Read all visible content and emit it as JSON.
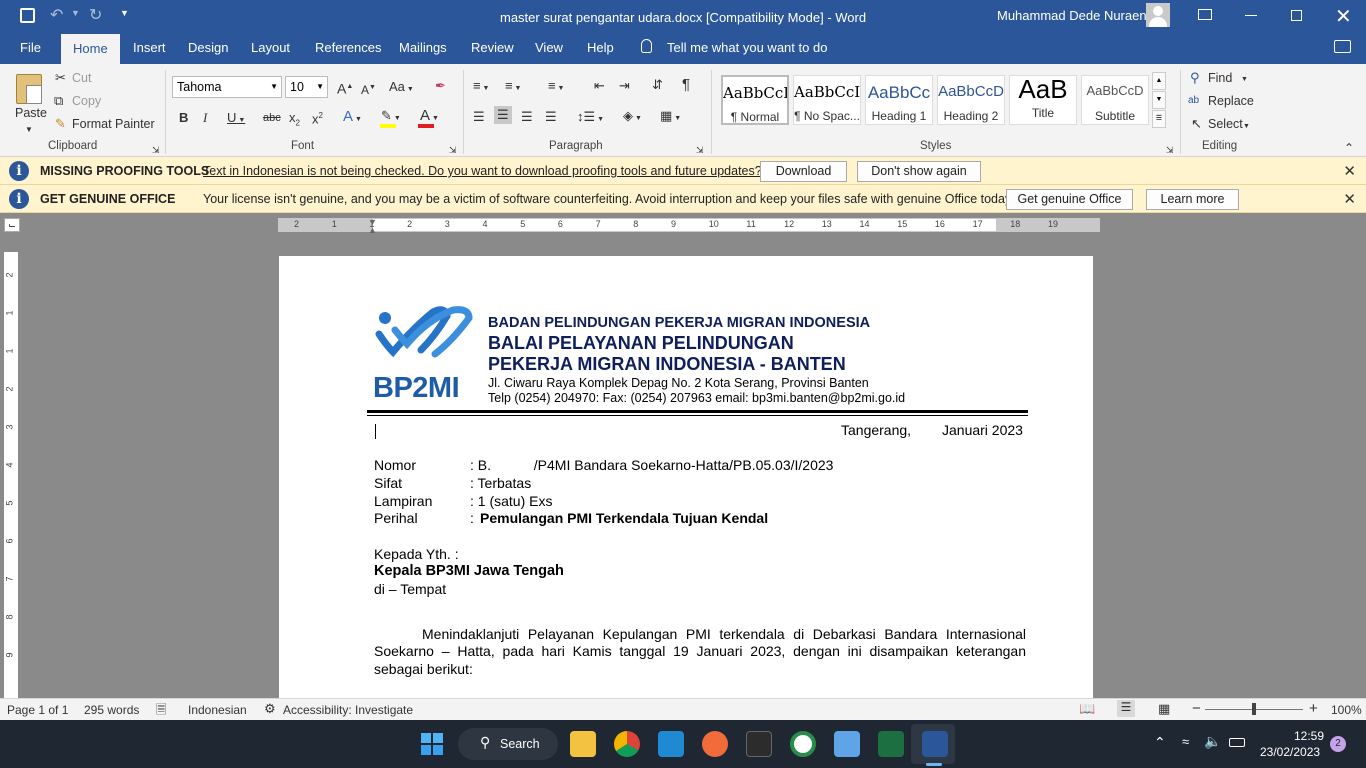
{
  "window": {
    "title": "master surat pengantar udara.docx [Compatibility Mode]  -  Word",
    "user": "Muhammad Dede Nuraen"
  },
  "tabs": [
    "File",
    "Home",
    "Insert",
    "Design",
    "Layout",
    "References",
    "Mailings",
    "Review",
    "View",
    "Help"
  ],
  "tell_me": "Tell me what you want to do",
  "clipboard": {
    "paste": "Paste",
    "cut": "Cut",
    "copy": "Copy",
    "format_painter": "Format Painter",
    "label": "Clipboard"
  },
  "font": {
    "name": "Tahoma",
    "size": "10",
    "label": "Font"
  },
  "paragraph": {
    "label": "Paragraph"
  },
  "styles": {
    "label": "Styles",
    "items": [
      {
        "sample": "AaBbCcI",
        "name": "¶ Normal"
      },
      {
        "sample": "AaBbCcI",
        "name": "¶ No Spac..."
      },
      {
        "sample": "AaBbCc",
        "name": "Heading 1"
      },
      {
        "sample": "AaBbCcD",
        "name": "Heading 2"
      },
      {
        "sample": "AaB",
        "name": "Title"
      },
      {
        "sample": "AaBbCcD",
        "name": "Subtitle"
      }
    ]
  },
  "editing": {
    "find": "Find",
    "replace": "Replace",
    "select": "Select",
    "label": "Editing"
  },
  "messages": [
    {
      "title": "MISSING PROOFING TOOLS",
      "text": "Text in Indonesian is not being checked. Do you want to download proofing tools and future updates?",
      "btn1": "Download",
      "btn2": "Don't show again"
    },
    {
      "title": "GET GENUINE OFFICE",
      "text": "Your license isn't genuine, and you may be a victim of software counterfeiting. Avoid interruption and keep your files safe with genuine Office today.",
      "btn1": "Get genuine Office",
      "btn2": "Learn more"
    }
  ],
  "ruler": {
    "h": [
      "2",
      "1",
      "1",
      "2",
      "3",
      "4",
      "5",
      "6",
      "7",
      "8",
      "9",
      "10",
      "11",
      "12",
      "13",
      "14",
      "15",
      "16",
      "17",
      "18",
      "19"
    ],
    "v": [
      "2",
      "1",
      "1",
      "2",
      "3",
      "4",
      "5",
      "6",
      "7",
      "8",
      "9"
    ]
  },
  "doc": {
    "logo_text": "BP2MI",
    "head1": "BADAN PELINDUNGAN PEKERJA MIGRAN  INDONESIA",
    "head2": "BALAI PELAYANAN PELINDUNGAN",
    "head3": "PEKERJA MIGRAN INDONESIA - BANTEN",
    "addr1": "Jl. Ciwaru  Raya  Komplek  Depag No.  2  Kota Serang,  Provinsi Banten",
    "addr2": "Telp  (0254)  204970:  Fax: (0254)  207963   email: bp3mi.banten@bp2mi.go.id",
    "date_place": "Tangerang,",
    "date": "Januari 2023",
    "fields": [
      {
        "k": "Nomor",
        "v": ": B.           /P4MI Bandara Soekarno-Hatta/PB.05.03/I/2023"
      },
      {
        "k": "Sifat",
        "v": ": Terbatas"
      },
      {
        "k": "Lampiran",
        "v": ": 1 (satu) Exs"
      },
      {
        "k": "Perihal",
        "v": ": ",
        "vb": "Pemulangan PMI Terkendala Tujuan Kendal"
      }
    ],
    "to1": "Kepada Yth. :",
    "to2": "Kepala BP3MI Jawa Tengah",
    "to3": "di – Tempat",
    "para_l1": "Menindaklanjuti Pelayanan Kepulangan PMI terkendala di Debarkasi Bandara Internasional",
    "para_l2": "Soekarno – Hatta, pada hari Kamis tanggal 19 Januari 2023, dengan ini disampaikan keterangan",
    "para_l3": "sebagai berikut:"
  },
  "status": {
    "page": "Page 1 of 1",
    "words": "295 words",
    "lang": "Indonesian",
    "access": "Accessibility: Investigate",
    "zoom": "100%"
  },
  "taskbar": {
    "search": "Search",
    "time": "12:59",
    "date": "23/02/2023",
    "badge": "2"
  }
}
